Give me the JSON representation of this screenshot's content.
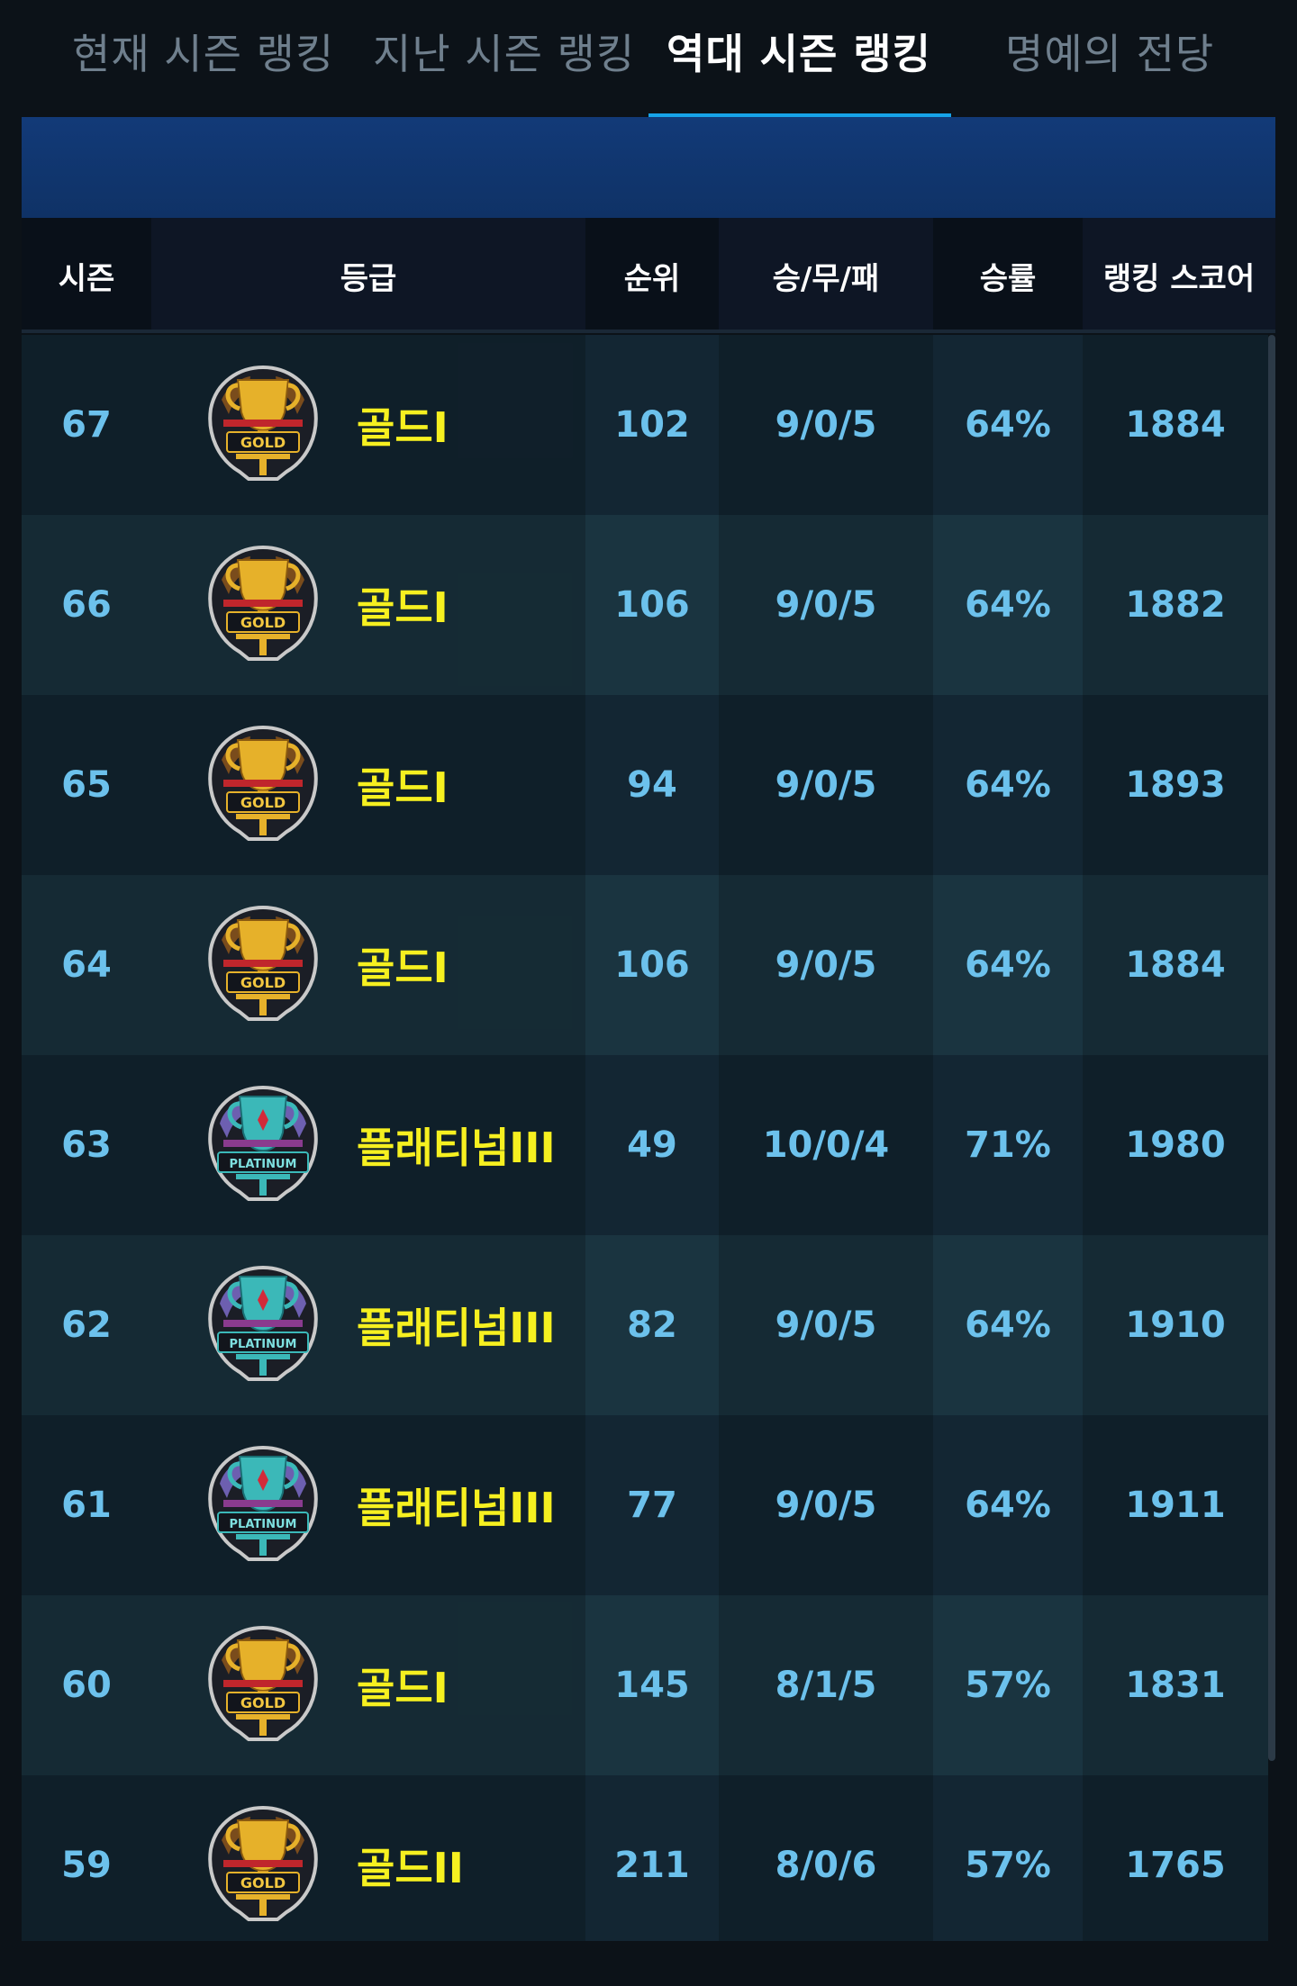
{
  "tabs": [
    {
      "label": "현재 시즌 랭킹"
    },
    {
      "label": "지난 시즌 랭킹"
    },
    {
      "label": "역대 시즌 랭킹"
    },
    {
      "label": "명예의 전당"
    }
  ],
  "active_tab": 2,
  "table": {
    "headers": [
      "시즌",
      "등급",
      "순위",
      "승/무/패",
      "승률",
      "랭킹 스코어"
    ],
    "rows": [
      {
        "season": "67",
        "grade": "골드I",
        "badge": "GOLD",
        "rank": "102",
        "record": "9/0/5",
        "winrate": "64%",
        "score": "1884"
      },
      {
        "season": "66",
        "grade": "골드I",
        "badge": "GOLD",
        "rank": "106",
        "record": "9/0/5",
        "winrate": "64%",
        "score": "1882"
      },
      {
        "season": "65",
        "grade": "골드I",
        "badge": "GOLD",
        "rank": "94",
        "record": "9/0/5",
        "winrate": "64%",
        "score": "1893"
      },
      {
        "season": "64",
        "grade": "골드I",
        "badge": "GOLD",
        "rank": "106",
        "record": "9/0/5",
        "winrate": "64%",
        "score": "1884"
      },
      {
        "season": "63",
        "grade": "플래티넘III",
        "badge": "PLATINUM",
        "rank": "49",
        "record": "10/0/4",
        "winrate": "71%",
        "score": "1980"
      },
      {
        "season": "62",
        "grade": "플래티넘III",
        "badge": "PLATINUM",
        "rank": "82",
        "record": "9/0/5",
        "winrate": "64%",
        "score": "1910"
      },
      {
        "season": "61",
        "grade": "플래티넘III",
        "badge": "PLATINUM",
        "rank": "77",
        "record": "9/0/5",
        "winrate": "64%",
        "score": "1911"
      },
      {
        "season": "60",
        "grade": "골드I",
        "badge": "GOLD",
        "rank": "145",
        "record": "8/1/5",
        "winrate": "57%",
        "score": "1831"
      },
      {
        "season": "59",
        "grade": "골드II",
        "badge": "GOLD",
        "rank": "211",
        "record": "8/0/6",
        "winrate": "57%",
        "score": "1765"
      }
    ]
  },
  "colors": {
    "accent": "#16a3e9",
    "grade_text": "#f6f020",
    "value_text": "#6cc1ec",
    "gold_badge": "#d9a521",
    "platinum_badge": "#35b5b5"
  },
  "icons": {
    "gold": "gold-trophy-badge-icon",
    "platinum": "platinum-trophy-badge-icon"
  }
}
